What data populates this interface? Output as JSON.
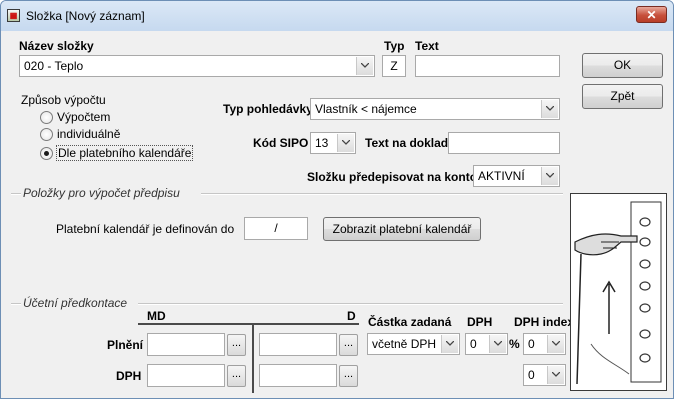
{
  "window": {
    "title": "Složka  [Nový záznam]",
    "close_glyph": "✕"
  },
  "header": {
    "nazev_slozky_label": "Název složky",
    "nazev_slozky_value": "020 - Teplo",
    "typ_label": "Typ",
    "typ_value": "Z",
    "text_label": "Text",
    "text_value": ""
  },
  "buttons": {
    "ok": "OK",
    "zpet": "Zpět",
    "zobrazit_kalendar": "Zobrazit platební kalendář"
  },
  "zpusob_vypoctu": {
    "label": "Způsob výpočtu",
    "options": [
      {
        "label": "Výpočtem",
        "checked": false
      },
      {
        "label": "individuálně",
        "checked": false
      },
      {
        "label": "Dle platebního kalendáře",
        "checked": true
      }
    ]
  },
  "typ_pohledavky": {
    "label": "Typ pohledávky",
    "value": "Vlastník < nájemce"
  },
  "kod_sipo": {
    "label": "Kód SIPO",
    "value": "13"
  },
  "text_na_doklad": {
    "label": "Text na doklad",
    "value": ""
  },
  "predepisovat": {
    "label": "Složku předepisovat na konto",
    "value": "AKTIVNÍ"
  },
  "polozky_group": {
    "title": "Položky pro výpočet předpisu",
    "kalendar_label": "Platební kalendář je definován do",
    "kalendar_value": "/"
  },
  "predkontace_group": {
    "title": "Účetní předkontace",
    "md_label": "MD",
    "d_label": "D",
    "castka_label": "Částka zadaná",
    "dph_label": "DPH",
    "dph_index_label": "DPH index",
    "rows": [
      {
        "label": "Plnění",
        "md": "",
        "d": "",
        "castka": "včetně DPH",
        "dph": "0",
        "percent": "%",
        "dph_index": "0"
      },
      {
        "label": "DPH",
        "md": "",
        "d": "",
        "dph_index": "0"
      }
    ],
    "dots_glyph": "..."
  },
  "illustration": {
    "description_icon": "hand-pointing-elevator-panel-sketch"
  }
}
